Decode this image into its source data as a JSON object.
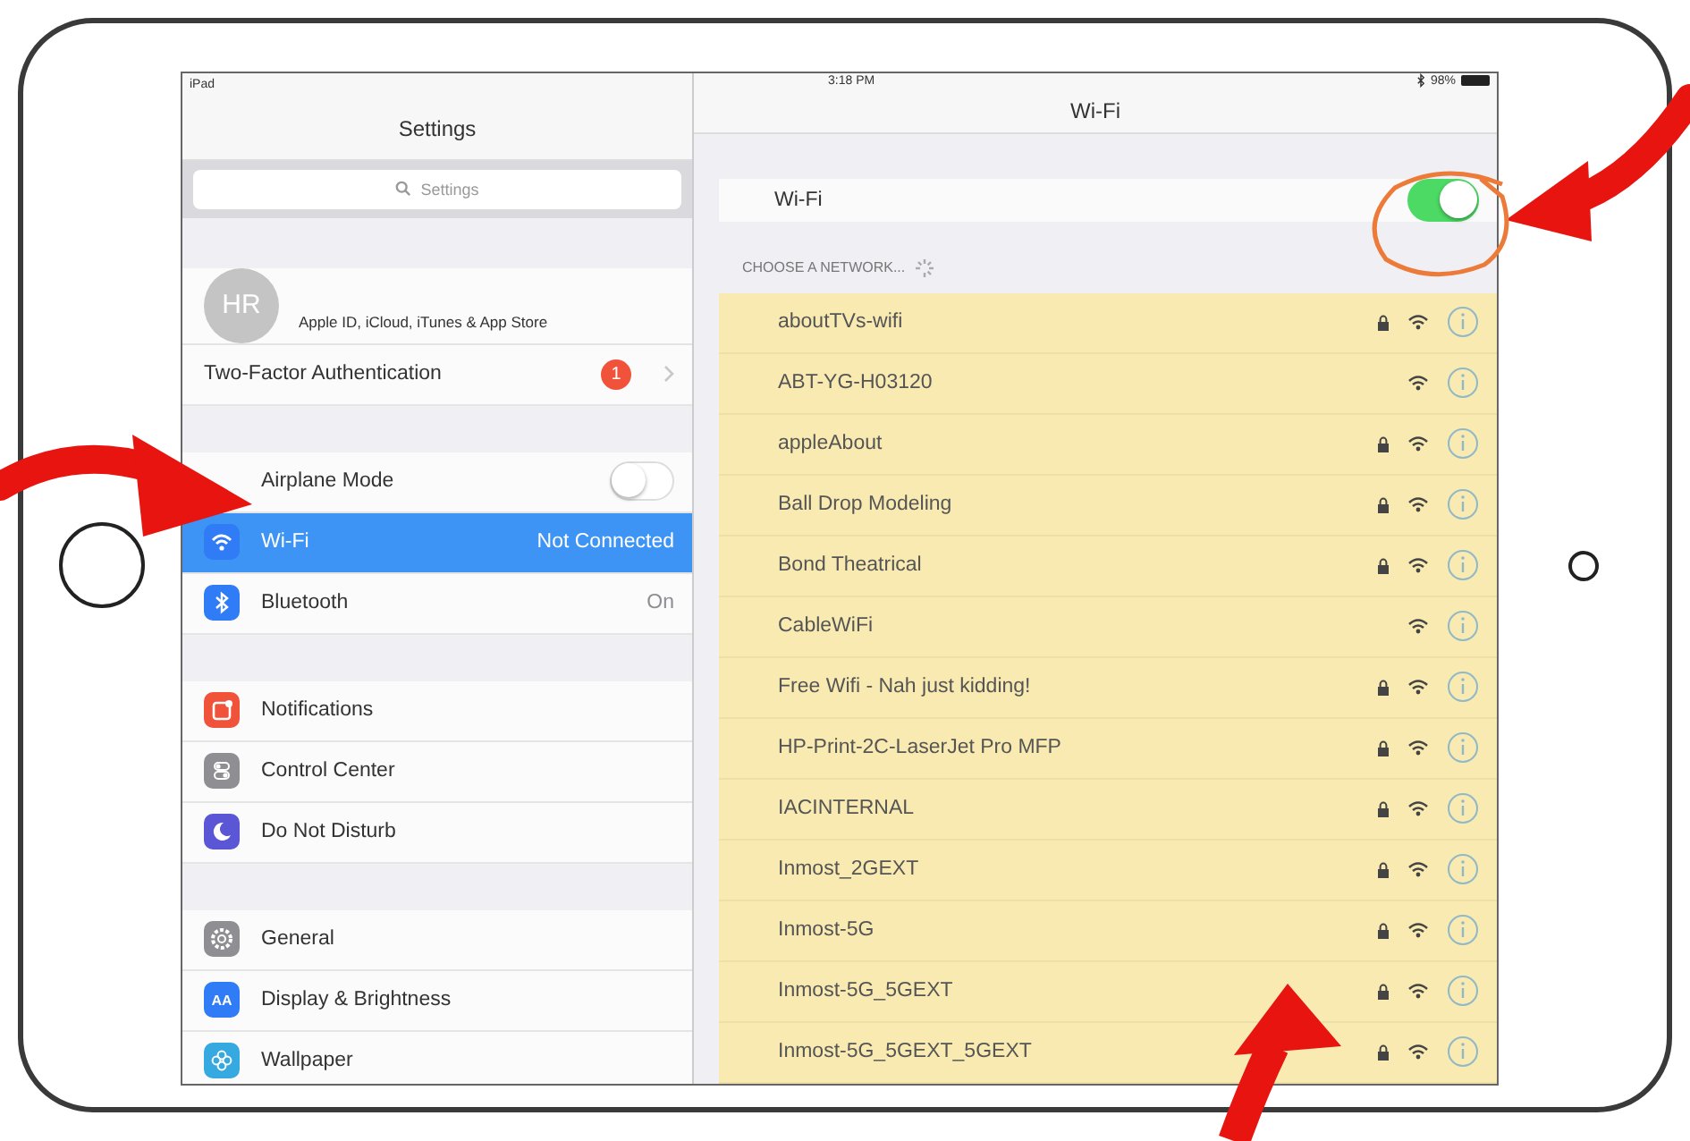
{
  "status_bar": {
    "device": "iPad",
    "time": "3:18 PM",
    "battery": "98%"
  },
  "sidebar": {
    "title": "Settings",
    "search": {
      "placeholder": "Settings"
    },
    "profile": {
      "initials": "HR",
      "subtitle": "Apple ID, iCloud, iTunes & App Store"
    },
    "groups": [
      [
        {
          "kind": "badge",
          "label": "Two-Factor Authentication",
          "badge": "1",
          "selected": false
        }
      ],
      [
        {
          "kind": "toggle",
          "label": "Airplane Mode",
          "on": false,
          "selected": false
        },
        {
          "kind": "value",
          "label": "Wi-Fi",
          "value": "Not Connected",
          "color": "#2f7cf6",
          "selected": true
        },
        {
          "kind": "value",
          "label": "Bluetooth",
          "value": "On",
          "color": "#2f7cf6",
          "selected": false
        }
      ],
      [
        {
          "kind": "link",
          "label": "Notifications",
          "color": "#f0533a",
          "selected": false
        },
        {
          "kind": "link",
          "label": "Control Center",
          "color": "#8e8e93",
          "selected": false
        },
        {
          "kind": "link",
          "label": "Do Not Disturb",
          "color": "#5b56d6",
          "selected": false
        }
      ],
      [
        {
          "kind": "link",
          "label": "General",
          "color": "#8e8e93",
          "selected": false
        },
        {
          "kind": "link",
          "label": "Display & Brightness",
          "tile_text": "AA",
          "color": "#2f7cf6",
          "selected": false
        },
        {
          "kind": "link",
          "label": "Wallpaper",
          "color": "#35a9e0",
          "selected": false
        }
      ]
    ]
  },
  "detail": {
    "title": "Wi-Fi",
    "wifi": {
      "label": "Wi-Fi",
      "on": true
    },
    "section": "CHOOSE A NETWORK...",
    "networks": [
      {
        "name": "aboutTVs-wifi",
        "locked": true
      },
      {
        "name": "ABT-YG-H03120",
        "locked": false
      },
      {
        "name": "appleAbout",
        "locked": true
      },
      {
        "name": "Ball Drop Modeling",
        "locked": true
      },
      {
        "name": "Bond Theatrical",
        "locked": true
      },
      {
        "name": "CableWiFi",
        "locked": false
      },
      {
        "name": "Free Wifi - Nah just kidding!",
        "locked": true
      },
      {
        "name": "HP-Print-2C-LaserJet Pro MFP",
        "locked": true
      },
      {
        "name": "IACINTERNAL",
        "locked": true
      },
      {
        "name": "Inmost_2GEXT",
        "locked": true
      },
      {
        "name": "Inmost-5G",
        "locked": true
      },
      {
        "name": "Inmost-5G_5GEXT",
        "locked": true
      },
      {
        "name": "Inmost-5G_5GEXT_5GEXT",
        "locked": true
      }
    ]
  }
}
